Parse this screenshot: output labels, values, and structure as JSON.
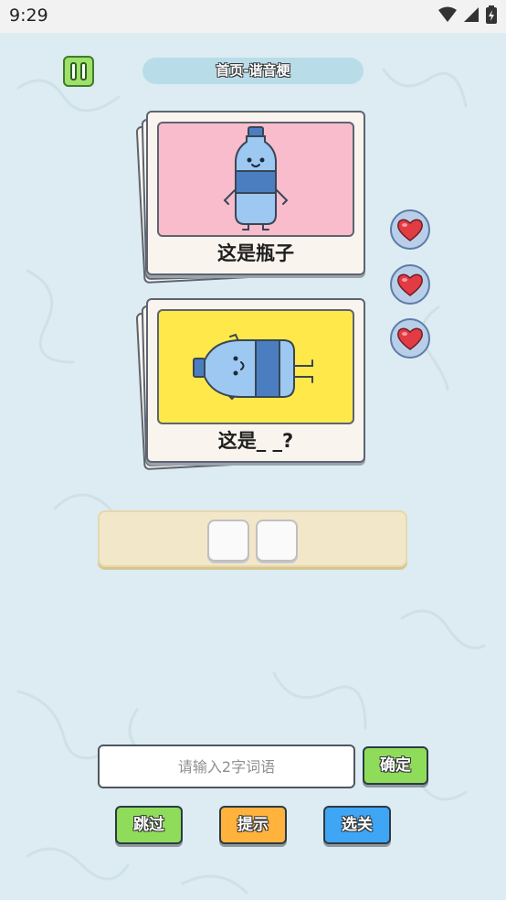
{
  "status": {
    "time": "9:29"
  },
  "header": {
    "level_title": "首页-谐音梗"
  },
  "cards": [
    {
      "caption": "这是瓶子",
      "image": "standing-bottle-character"
    },
    {
      "caption": "这是_ _?",
      "image": "lying-bottle-character"
    }
  ],
  "lives": {
    "count": 3,
    "icon": "heart-icon"
  },
  "answer": {
    "slots": [
      "",
      ""
    ]
  },
  "input": {
    "placeholder": "请输入2字词语",
    "value": ""
  },
  "buttons": {
    "confirm": "确定",
    "skip": "跳过",
    "hint": "提示",
    "select_level": "选关"
  },
  "colors": {
    "background": "#dcecf2",
    "card_pink": "#f8bccc",
    "card_yellow": "#ffe84a",
    "green_button": "#8fdc5b",
    "orange_button": "#ffb23c",
    "blue_button": "#3ea6f5",
    "heart": "#e23b44"
  }
}
